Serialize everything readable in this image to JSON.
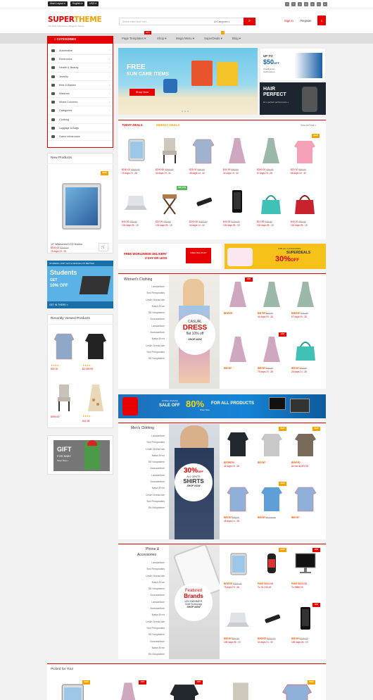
{
  "topbar": {
    "layout_select": "Main Layout",
    "language_select": "English",
    "currency_select": "USD"
  },
  "header": {
    "logo_main": "SUPER",
    "logo_accent": "THEME",
    "tagline": "The Best SuperHome Magento Theme",
    "search_placeholder": "Search entire store here...",
    "search_category": "All Categories",
    "signin": "Sign in",
    "register": "Register",
    "cart_count": "0"
  },
  "nav": {
    "items": [
      "Page Templates",
      "Shop",
      "Mega Menu",
      "SuperDeals",
      "Blog"
    ],
    "tag_hot": "HOT",
    "tag_new": "!"
  },
  "categories": {
    "title": "CATEGORIES",
    "items": [
      "Automotive",
      "Electronics",
      "Health & Beauty",
      "Jewelry",
      "Kids & Babies",
      "Watches",
      "Mixed Columns",
      "Categories",
      "Clothing",
      "Luggage & Bags",
      "Game electronics"
    ]
  },
  "new_products": {
    "title": "New Products",
    "badge": "NEW",
    "name": "19\" Widescreen LCD Monitor",
    "price": "$100.00",
    "old_price": "$300.00",
    "timer": "75 days 19 : 28"
  },
  "student_banner": {
    "top": "STUDENG JUST GOT A WHOLE LOT BETTER",
    "title": "Students",
    "get": "GET",
    "off": "10% OFF",
    "cta": "GET IN THERE »"
  },
  "recently_viewed": {
    "title": "Recently Viewed Products",
    "items": [
      {
        "price": "$30.00",
        "old": ""
      },
      {
        "price": "$2,099.99",
        "old": ""
      },
      {
        "price": "$999.00",
        "old": ""
      },
      {
        "price": "$41.99",
        "old": ""
      }
    ]
  },
  "gift_banner": {
    "title": "GIFT",
    "sub": "FOR BABY",
    "cta": "Shop Now »"
  },
  "hero": {
    "free": "FREE",
    "title": "SUN CARE ITEMS",
    "cta": "Shop Now",
    "promo1_line1": "UP TO",
    "promo1_amount": "$50",
    "promo1_off": "OFF",
    "promo1_sub": "Oral-B power toothbrushes",
    "promo2_line1": "HAIR",
    "promo2_line2": "PERFECT",
    "promo2_sub": "for a perfect performance »"
  },
  "deals": {
    "tab_today": "TODAY DEALS",
    "tab_weekly": "WEEKLY DEALS",
    "view_all": "View All Deal »",
    "row1": [
      {
        "price": "$180.00",
        "old": "$300.00",
        "timer": "75 days 19 : 28",
        "badge": ""
      },
      {
        "price": "$200.00",
        "old": "$300.00",
        "timer": "44 days 19 : 31",
        "badge": ""
      },
      {
        "price": "$25.00",
        "old": "$30.00",
        "timer": "48 days 14 : 32",
        "badge": ""
      },
      {
        "price": "$41.99",
        "old": "$50.00",
        "timer": "44 days 19 : 32",
        "badge": ""
      },
      {
        "price": "$300.00",
        "old": "$36.00",
        "timer": "67 days 19 : 28",
        "badge": ""
      },
      {
        "price": "$23.00",
        "old": "$30.00",
        "timer": "68 days 19 : 30",
        "badge": "NEW"
      }
    ],
    "row2": [
      {
        "price": "$40.00",
        "old": "$36.00",
        "timer": "135 days 05 : 19",
        "badge": ""
      },
      {
        "price": "$20.00",
        "old": "$30.00",
        "timer": "135 days 05 : 19",
        "badge": "OFF 17%"
      },
      {
        "price": "$240.00",
        "old": "$300.00",
        "timer": "44 days 14 : 32",
        "badge": ""
      },
      {
        "price": "$40.00",
        "old": "$129.00",
        "timer": "135 days 05 : 19",
        "badge": ""
      },
      {
        "price": "$10.00",
        "old": "$28.00",
        "timer": "130 days 05 : 19",
        "badge": ""
      },
      {
        "price": "$40.00",
        "old": "$56.00",
        "timer": "130 days 05 : 19",
        "badge": ""
      }
    ]
  },
  "delivery_banner": {
    "line1": "FREE WORLDWIDE DELIVERY",
    "line2": "3 DAY OR LESS",
    "truck": "FREE DELIVERY"
  },
  "superdeals_banner": {
    "for_all": "FOR ALL CATEGORIES",
    "name": "SUPERDEALS",
    "pct": "30%",
    "off": "OFF"
  },
  "womens": {
    "title": "Women's Clothing",
    "links": [
      "Laudantium",
      "Sed Perspiciatis",
      "Unde Omnis Iste",
      "Natus Error",
      "Sit Voluptatem",
      "Accusantium",
      "Laudantium",
      "Accusantium",
      "Natus Error",
      "Unde Omnis Iste",
      "Sed Perspiciatis",
      "Sit Voluptatem"
    ],
    "banner_casual": "CASUAL",
    "banner_dress": "DRESS",
    "banner_flat": "flat 10% off",
    "banner_shop": "SHOP NOW",
    "products": [
      {
        "price": "$150.00",
        "old": "",
        "timer": "",
        "badge": "HOT"
      },
      {
        "price": "$41.99",
        "old": "$50.00",
        "timer": "44 days 19 : 28",
        "badge": ""
      },
      {
        "price": "$300.00",
        "old": "$36.00",
        "timer": "67 days 19 : 28",
        "badge": ""
      },
      {
        "price": "$30.00",
        "old": "",
        "timer": "",
        "badge": ""
      },
      {
        "price": "$50.00",
        "old": "$48.00",
        "timer": "75 days 19 : 28",
        "badge": "HOT"
      },
      {
        "price": "$10.00",
        "old": "$28.00",
        "timer": "26 days 14 : 28",
        "badge": ""
      }
    ]
  },
  "holiday_banner": {
    "small": "Holiday shopping",
    "sale": "SALE OFF",
    "pct": "80%",
    "all": "FOR ALL PRODUCTS",
    "shop": "Shop Now"
  },
  "mens": {
    "title": "Men's Clothing",
    "links": [
      "Laudantium",
      "Sed Perspiciatis",
      "Unde Omnis Iste",
      "Natus Error",
      "Sit Voluptatem",
      "Accusantium",
      "Laudantium",
      "Accusantium",
      "Natus Error",
      "Unde Omnis Iste",
      "Sed Perspiciatis",
      "Sit Voluptatem"
    ],
    "banner_pct": "30%",
    "banner_off": "OFF",
    "banner_all": "ALL GENTS",
    "banner_shirts": "SHIRTS",
    "banner_shop": "SHOP NOW",
    "products": [
      {
        "price": "$2,099.99",
        "old": "",
        "timer": "44 days 19 : 28",
        "badge": ""
      },
      {
        "price": "$15.00",
        "old": "",
        "timer": "",
        "badge": "NEW"
      },
      {
        "price": "$100.00",
        "old": "",
        "timer": "As low as $70.00",
        "badge": "NEW"
      },
      {
        "price": "$20.00",
        "old": "$26.00",
        "timer": "48 days 14 : 28",
        "badge": ""
      },
      {
        "price": "$18.00",
        "old": "As low as",
        "timer": "",
        "badge": "NEW"
      },
      {
        "price": "$60.00",
        "old": "",
        "timer": "",
        "badge": ""
      }
    ]
  },
  "phones": {
    "title1": "Phone &",
    "title2": "Accessories",
    "links": [
      "Laudantium",
      "Sed Perspiciatis",
      "Unde Omnis Iste",
      "Natus Error",
      "Sit Voluptatem",
      "Accusantium",
      "Laudantium",
      "Accusantium",
      "Natus Error",
      "Unde Omnis Iste",
      "Sed Perspiciatis",
      "Sit Voluptatem",
      "Accusantium",
      "Natus Error",
      "Sit Voluptatem"
    ],
    "banner_featured": "Featured",
    "banner_brands": "Brands",
    "banner_brand": "UM HAMMER",
    "banner_tech": "Solid Technology",
    "banner_shop": "SHOP NOW",
    "products": [
      {
        "price": "$100.00",
        "old": "$300.00",
        "timer": "75 days 19 : 28",
        "badge": ""
      },
      {
        "price": "From: $441.98",
        "old": "",
        "timer": "To: $1,919.49",
        "badge": "NEW"
      },
      {
        "price": "From: $429.35",
        "old": "",
        "timer": "To: $880.09",
        "badge": "HOT"
      },
      {
        "price": "$40.00",
        "old": "$36.00",
        "timer": "135 days 05 : 19",
        "badge": ""
      },
      {
        "price": "$240.00",
        "old": "$300.00",
        "timer": "44 days 14 : 32",
        "badge": ""
      },
      {
        "price": "$40.00",
        "old": "$129.00",
        "timer": "135 days 05 : 19",
        "badge": "HOT"
      }
    ]
  },
  "picked": {
    "title": "Picked for You!",
    "badges": [
      "NEW",
      "HOT",
      "HOT",
      "",
      "NEW"
    ]
  }
}
